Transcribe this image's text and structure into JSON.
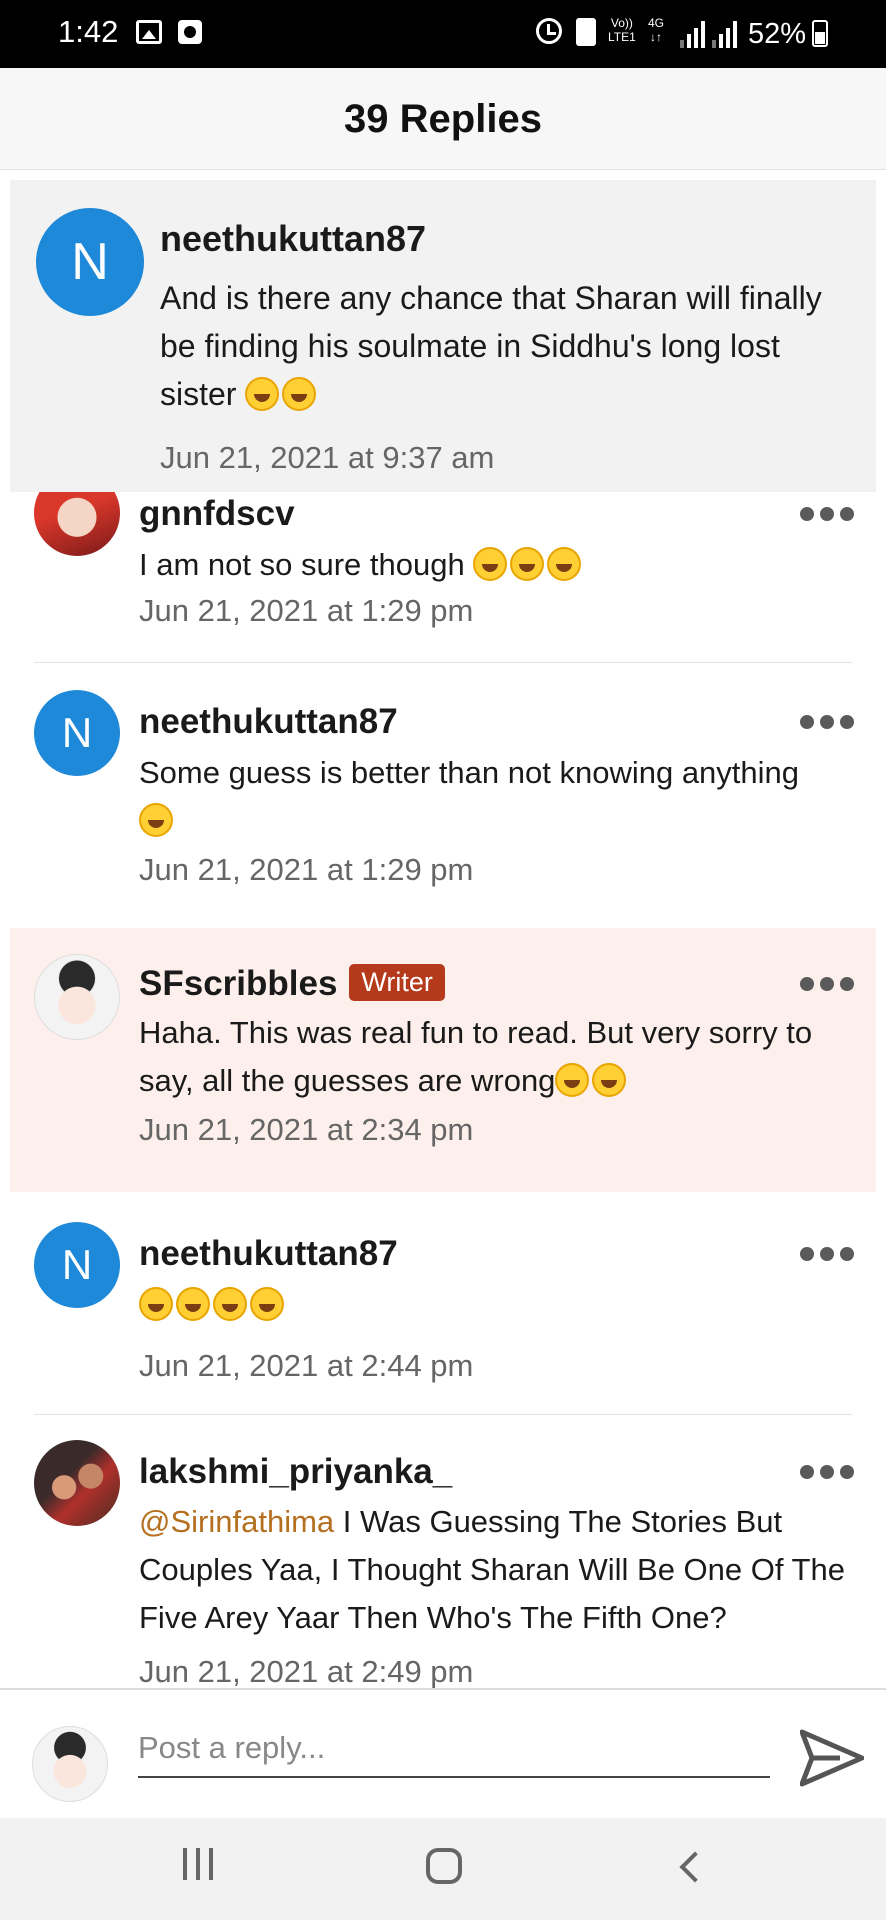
{
  "status_bar": {
    "time": "1:42",
    "volte_line1": "Vo))",
    "volte_line2": "LTE1",
    "network_line1": "4G",
    "network_line2": "↓↑",
    "battery": "52%"
  },
  "header": {
    "title": "39 Replies"
  },
  "parent_comment": {
    "avatar_letter": "N",
    "username": "neethukuttan87",
    "text": "And is there any chance that Sharan will finally be finding his soulmate in Siddhu's long lost sister",
    "emoji_count": 2,
    "timestamp": "Jun 21, 2021 at 9:37 am"
  },
  "replies": [
    {
      "username": "gnnfdscv",
      "text": "I am not so sure though",
      "emoji_count": 3,
      "timestamp": "Jun 21, 2021 at 1:29 pm",
      "avatar": "girl-red-icon"
    },
    {
      "username": "neethukuttan87",
      "avatar_letter": "N",
      "text": "Some guess is better than not knowing anything",
      "emoji_count": 1,
      "timestamp": "Jun 21, 2021 at 1:29 pm"
    },
    {
      "username": "SFscribbles",
      "badge": "Writer",
      "text": "Haha. This was real fun to read. But very sorry to say, all the guesses are wrong",
      "emoji_count": 2,
      "timestamp": "Jun 21, 2021 at 2:34 pm",
      "avatar": "chibi-icon",
      "highlight": "#fdf0ec"
    },
    {
      "username": "neethukuttan87",
      "avatar_letter": "N",
      "text": "",
      "emoji_count": 4,
      "timestamp": "Jun 21, 2021 at 2:44 pm"
    },
    {
      "username": "lakshmi_priyanka_",
      "mention": "@Sirinfathima",
      "text": " I Was Guessing The Stories But Couples Yaa, I Thought Sharan Will Be One Of The Five Arey Yaar Then Who's The Fifth One?",
      "timestamp": "Jun 21, 2021 at 2:49 pm",
      "avatar": "couple-icon"
    }
  ],
  "composer": {
    "placeholder": "Post a reply..."
  },
  "colors": {
    "avatar_blue": "#1e88d9",
    "writer_badge": "#b5391b",
    "mention": "#b46f1f"
  }
}
